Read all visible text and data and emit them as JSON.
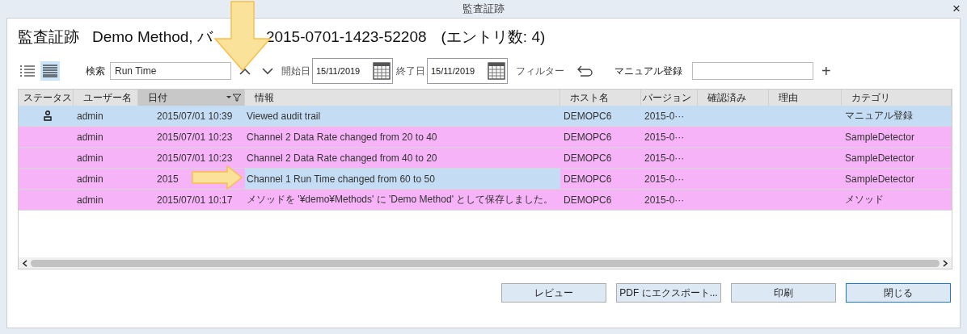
{
  "window": {
    "title": "監査証跡",
    "close": "×"
  },
  "heading": {
    "app": "監査証跡",
    "before_arrow": "Demo Method, バ",
    "after_arrow": "2015-0701-1423-52208",
    "count": "(エントリ数: 4)"
  },
  "view_modes": [
    {
      "kind": "list",
      "selected": false
    },
    {
      "kind": "details",
      "selected": true
    }
  ],
  "search": {
    "label": "検索",
    "value": "Run Time"
  },
  "start_date": {
    "label": "開始日",
    "value": "15/11/2019"
  },
  "end_date": {
    "label": "終了日",
    "value": "15/11/2019"
  },
  "filter": {
    "label": "フィルター"
  },
  "manual_entry": {
    "label": "マニュアル登録",
    "add": "+"
  },
  "table": {
    "columns": [
      {
        "label": "ステータス",
        "sorted": false
      },
      {
        "label": "ユーザー名",
        "sorted": false
      },
      {
        "label": "日付",
        "sorted": true
      },
      {
        "label": "情報",
        "sorted": false
      },
      {
        "label": "ホスト名",
        "sorted": false
      },
      {
        "label": "バージョン",
        "sorted": false
      },
      {
        "label": "確認済み",
        "sorted": false
      },
      {
        "label": "理由",
        "sorted": false
      },
      {
        "label": "カテゴリ",
        "sorted": false
      }
    ],
    "rows": [
      {
        "selected": true,
        "manual": true,
        "info_selected": false,
        "user": "admin",
        "date": "2015/07/01 10:39",
        "info": "Viewed audit trail",
        "host": "DEMOPC6",
        "version": "2015-0···",
        "category": "マニュアル登録"
      },
      {
        "selected": false,
        "manual": false,
        "info_selected": false,
        "user": "admin",
        "date": "2015/07/01 10:23",
        "info": "Channel 2 Data Rate changed from 20 to 40",
        "host": "DEMOPC6",
        "version": "2015-0···",
        "category": "SampleDetector"
      },
      {
        "selected": false,
        "manual": false,
        "info_selected": false,
        "user": "admin",
        "date": "2015/07/01 10:23",
        "info": "Channel 2 Data Rate changed from 40 to 20",
        "host": "DEMOPC6",
        "version": "2015-0···",
        "category": "SampleDetector"
      },
      {
        "selected": false,
        "manual": false,
        "info_selected": true,
        "user": "admin",
        "date": "2015",
        "info": "Channel 1 Run Time changed from 60 to 50",
        "host": "DEMOPC6",
        "version": "2015-0···",
        "category": "SampleDetector"
      },
      {
        "selected": false,
        "manual": false,
        "info_selected": false,
        "user": "admin",
        "date": "2015/07/01 10:17",
        "info": "メソッドを '¥demo¥Methods' に 'Demo Method' として保存しました。",
        "host": "DEMOPC6",
        "version": "2015-0···",
        "category": "メソッド"
      }
    ]
  },
  "buttons": [
    {
      "label": "レビュー",
      "selected": false
    },
    {
      "label": "PDF にエクスポート...",
      "selected": false
    },
    {
      "label": "印刷",
      "selected": false
    },
    {
      "label": "閉じる",
      "selected": true
    }
  ]
}
